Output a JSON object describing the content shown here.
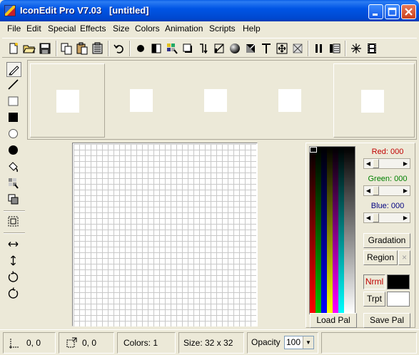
{
  "window": {
    "title": "IconEdit Pro V7.03   [untitled]"
  },
  "menu": [
    "File",
    "Edit",
    "Special",
    "Effects",
    "Size",
    "Colors",
    "Animation",
    "Scripts",
    "Help"
  ],
  "color_panel": {
    "red_label": "Red: 000",
    "green_label": "Green: 000",
    "blue_label": "Blue: 000",
    "gradation_label": "Gradation",
    "region_label": "Region",
    "region_close": "×",
    "nrml_label": "Nrml",
    "trpt_label": "Trpt",
    "load_pal_label": "Load Pal",
    "save_pal_label": "Save Pal",
    "colors": {
      "red": "#C00000",
      "green": "#008000",
      "blue": "#000080",
      "nrml_swatch": "#000000",
      "trpt_swatch": "#FFFFFF"
    }
  },
  "status": {
    "cursor_pos": "0, 0",
    "selection_size": "0, 0",
    "colors": "Colors:  1",
    "size": "Size:   32 x 32",
    "opacity_label": "Opacity",
    "opacity_value": "100"
  }
}
